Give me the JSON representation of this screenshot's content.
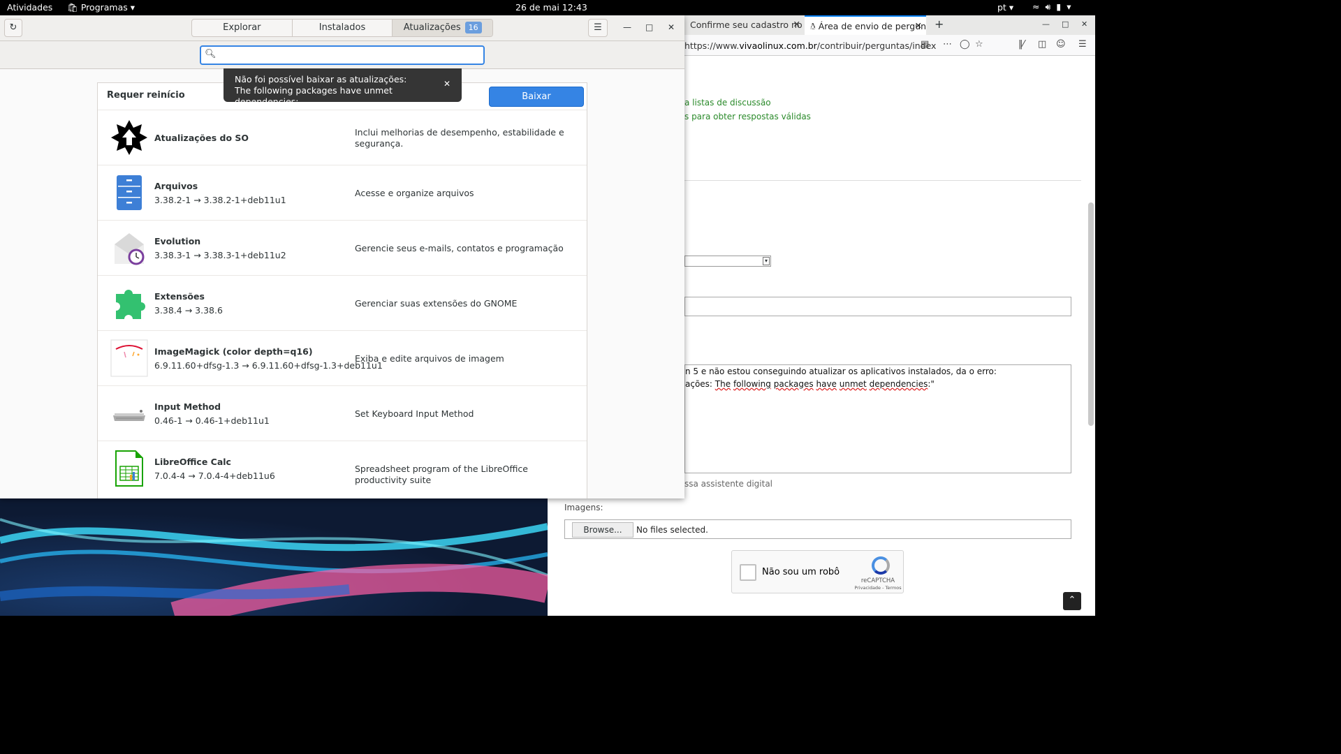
{
  "topbar": {
    "activities": "Atividades",
    "apps": "Programas",
    "clock": "26 de mai  12:43",
    "lang": "pt"
  },
  "software": {
    "tabs": [
      {
        "label": "Explorar"
      },
      {
        "label": "Instalados"
      },
      {
        "label": "Atualizações",
        "badge": "16"
      }
    ],
    "search_placeholder": "",
    "toast": {
      "line1": "Não foi possível baixar as atualizações:",
      "line2": "The following packages have unmet dependencies:"
    },
    "section_title": "Requer reinício",
    "download_label": "Baixar",
    "updates": [
      {
        "name": "Atualizações do SO",
        "version": "",
        "desc": "Inclui melhorias de desempenho, estabilidade e segurança."
      },
      {
        "name": "Arquivos",
        "version": "3.38.2-1 → 3.38.2-1+deb11u1",
        "desc": "Acesse e organize arquivos"
      },
      {
        "name": "Evolution",
        "version": "3.38.3-1 → 3.38.3-1+deb11u2",
        "desc": "Gerencie seus e-mails, contatos e programação"
      },
      {
        "name": "Extensões",
        "version": "3.38.4 → 3.38.6",
        "desc": "Gerenciar suas extensões do GNOME"
      },
      {
        "name": "ImageMagick (color depth=q16)",
        "version": "6.9.11.60+dfsg-1.3 → 6.9.11.60+dfsg-1.3+deb11u1",
        "desc": "Exiba e edite arquivos de imagem"
      },
      {
        "name": "Input Method",
        "version": "0.46-1 → 0.46-1+deb11u1",
        "desc": "Set Keyboard Input Method"
      },
      {
        "name": "LibreOffice Calc",
        "version": "7.0.4-4 → 7.0.4-4+deb11u6",
        "desc": "Spreadsheet program of the LibreOffice productivity suite"
      }
    ]
  },
  "browser": {
    "tabs": [
      {
        "title": "Confirme seu cadastro no"
      },
      {
        "title": "Área de envio de perguntas"
      }
    ],
    "url_prefix": "https://www.",
    "url_host": "vivaolinux.com.br",
    "url_path": "/contribuir/perguntas/index",
    "links": [
      "a listas de discussão",
      "s para obter respostas válidas"
    ],
    "textarea_line1": "n 5 e não estou conseguindo atualizar os aplicativos instalados, da o erro:",
    "textarea_line2_prefix": "ações: ",
    "textarea_line2_words": [
      "The",
      "following",
      "packages",
      "have",
      "unmet",
      "dependencies"
    ],
    "textarea_line2_suffix": ":\"",
    "hint": "ssa assistente digital",
    "images_label": "Imagens:",
    "browse_label": "Browse...",
    "no_files": "No files selected.",
    "captcha_label": "Não sou um robô",
    "captcha_brand": "reCAPTCHA",
    "captcha_terms": "Privacidade - Termos"
  }
}
